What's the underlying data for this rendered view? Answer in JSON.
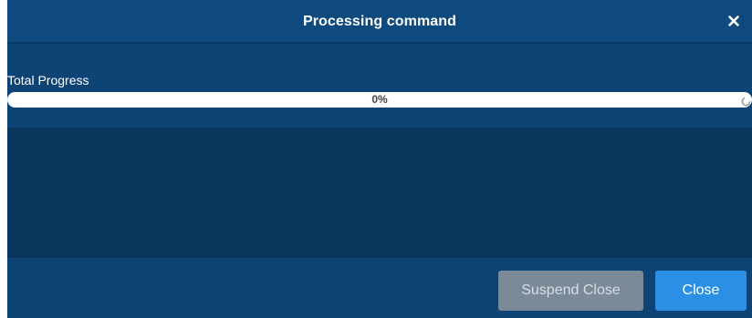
{
  "dialog": {
    "title": "Processing command",
    "close_icon": "close-icon"
  },
  "progress": {
    "label": "Total Progress",
    "percent_text": "0%",
    "value": 0,
    "spinner_icon": "spinner-icon"
  },
  "footer": {
    "suspend_close_label": "Suspend Close",
    "close_label": "Close"
  },
  "colors": {
    "dialog_bg": "#0e4475",
    "log_bg": "#0a355c",
    "accent": "#2b8fe6",
    "disabled_button": "#7b8a98"
  }
}
